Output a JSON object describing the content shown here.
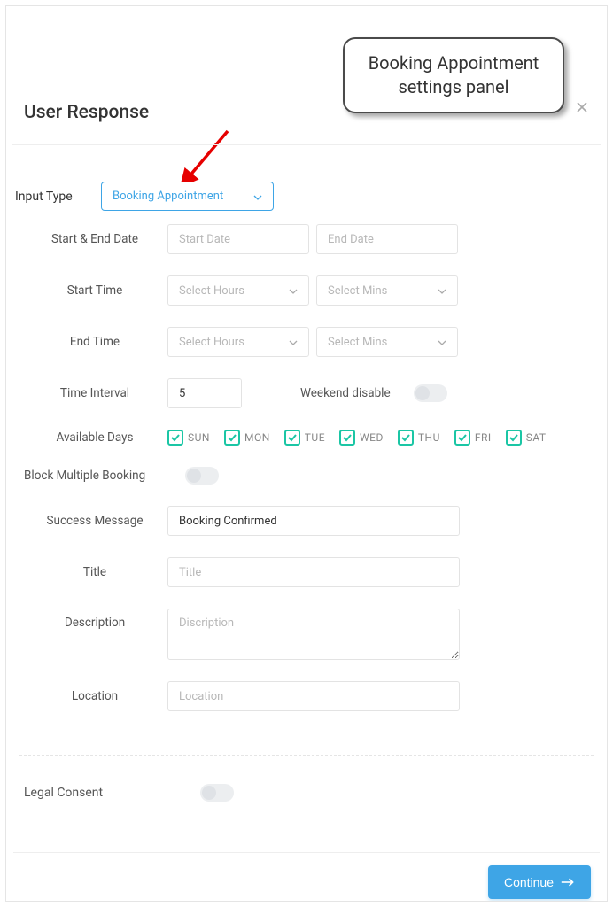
{
  "callout_text": "Booking Appointment settings panel",
  "heading": "User Response",
  "labels": {
    "input_type": "Input Type",
    "start_end_date": "Start & End Date",
    "start_time": "Start Time",
    "end_time": "End Time",
    "time_interval": "Time Interval",
    "weekend_disable": "Weekend disable",
    "available_days": "Available Days",
    "block_multi": "Block Multiple Booking",
    "success_msg": "Success Message",
    "title": "Title",
    "description": "Description",
    "location": "Location",
    "legal": "Legal Consent"
  },
  "input_type_value": "Booking Appointment",
  "placeholders": {
    "start_date": "Start Date",
    "end_date": "End Date",
    "hours": "Select Hours",
    "mins": "Select Mins",
    "title": "Title",
    "description": "Discription",
    "location": "Location"
  },
  "values": {
    "time_interval": "5",
    "success_message": "Booking Confirmed"
  },
  "days": [
    "SUN",
    "MON",
    "TUE",
    "WED",
    "THU",
    "FRI",
    "SAT"
  ],
  "continue_label": "Continue",
  "colors": {
    "accent_blue": "#3ea5e6",
    "accent_teal": "#1bc6a5"
  }
}
